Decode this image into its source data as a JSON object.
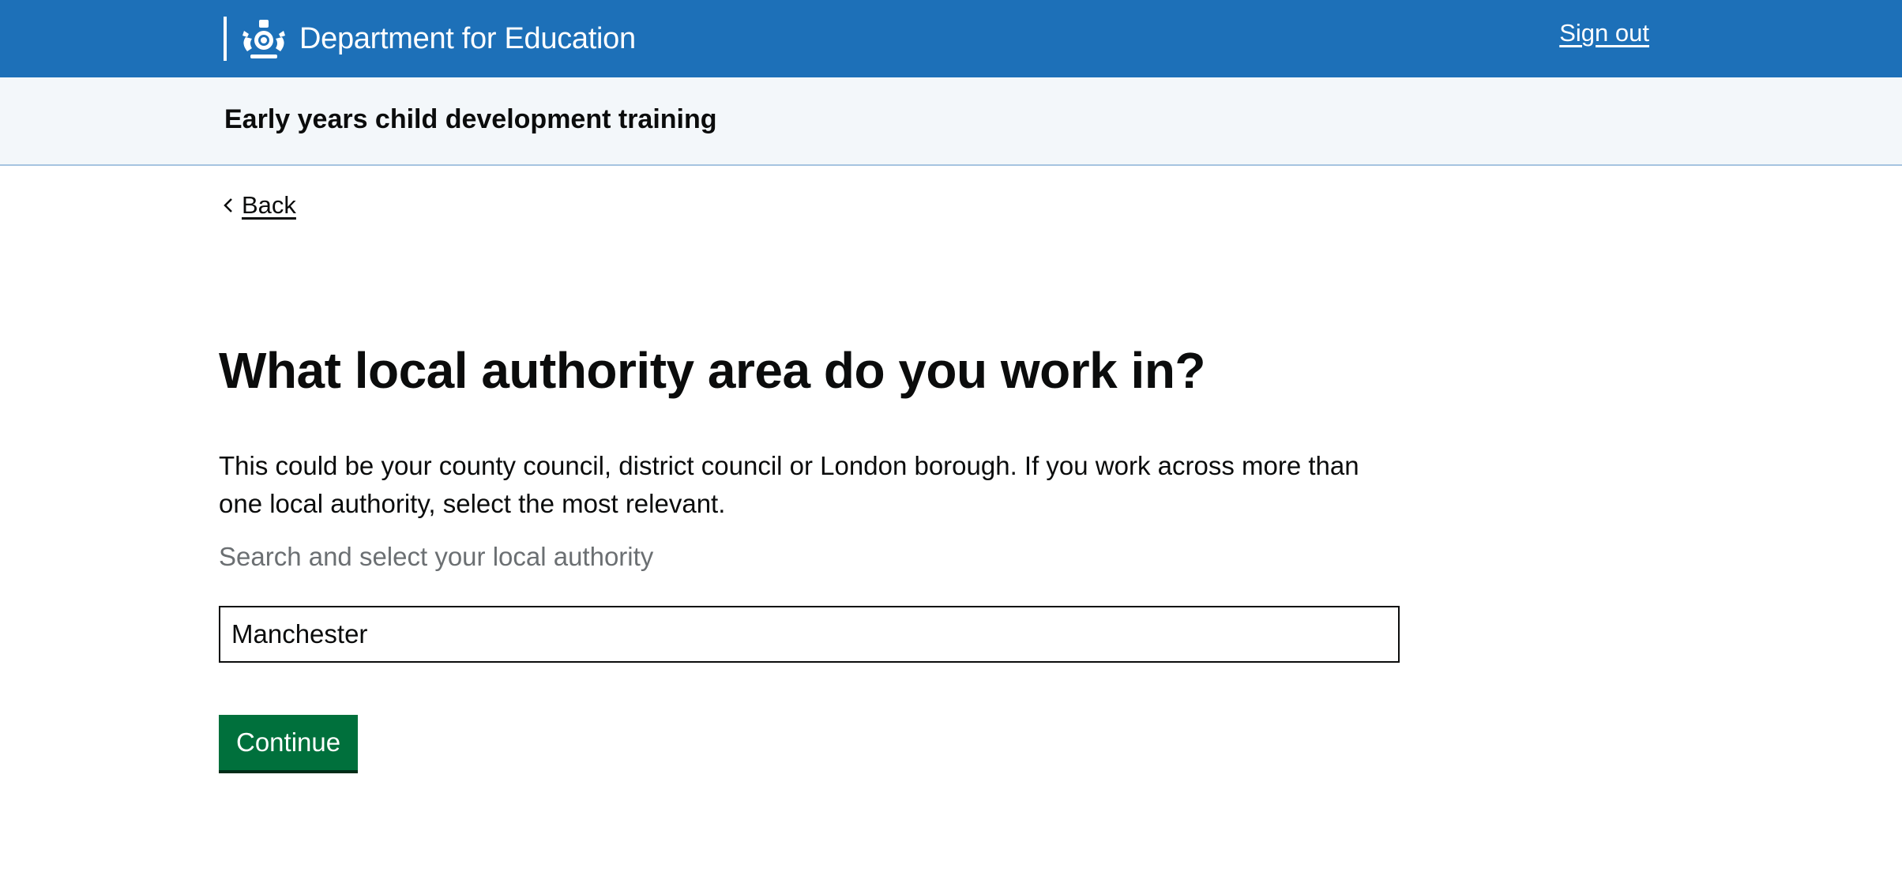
{
  "header": {
    "org_name": "Department for Education",
    "crest_icon": "royal-coat-of-arms-icon",
    "sign_out_label": "Sign out",
    "background_color": "#1d70b8"
  },
  "service": {
    "name": "Early years child development training"
  },
  "back_link": {
    "icon": "chevron-left-icon",
    "label": "Back"
  },
  "main": {
    "heading": "What local authority area do you work in?",
    "hint": "This could be your county council, district council or London borough. If you work across more than one local authority, select the most relevant.",
    "label": "Search and select your local authority",
    "input_value": "Manchester",
    "continue_label": "Continue",
    "button_color": "#00703c"
  }
}
